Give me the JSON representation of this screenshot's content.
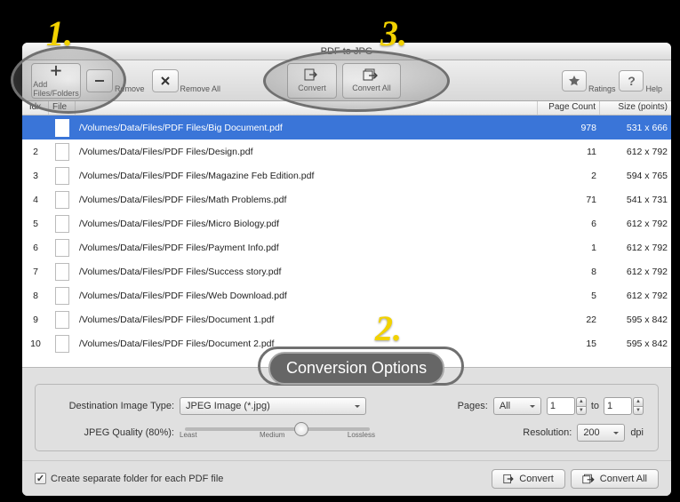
{
  "window_title": "PDF to JPG",
  "toolbar": {
    "add_label": "Add Files/Folders",
    "remove_label": "Remove",
    "remove_all_label": "Remove All",
    "convert_label": "Convert",
    "convert_all_label": "Convert All",
    "ratings_label": "Ratings",
    "help_label": "Help"
  },
  "columns": {
    "idx": "Idx",
    "file": "File",
    "path": "",
    "pages": "Page Count",
    "size": "Size (points)"
  },
  "files": [
    {
      "idx": "",
      "path": "/Volumes/Data/Files/PDF Files/Big Document.pdf",
      "pages": "978",
      "size": "531 x 666",
      "sel": true
    },
    {
      "idx": "2",
      "path": "/Volumes/Data/Files/PDF Files/Design.pdf",
      "pages": "11",
      "size": "612 x 792"
    },
    {
      "idx": "3",
      "path": "/Volumes/Data/Files/PDF Files/Magazine Feb Edition.pdf",
      "pages": "2",
      "size": "594 x 765"
    },
    {
      "idx": "4",
      "path": "/Volumes/Data/Files/PDF Files/Math Problems.pdf",
      "pages": "71",
      "size": "541 x 731"
    },
    {
      "idx": "5",
      "path": "/Volumes/Data/Files/PDF Files/Micro Biology.pdf",
      "pages": "6",
      "size": "612 x 792"
    },
    {
      "idx": "6",
      "path": "/Volumes/Data/Files/PDF Files/Payment Info.pdf",
      "pages": "1",
      "size": "612 x 792"
    },
    {
      "idx": "7",
      "path": "/Volumes/Data/Files/PDF Files/Success story.pdf",
      "pages": "8",
      "size": "612 x 792"
    },
    {
      "idx": "8",
      "path": "/Volumes/Data/Files/PDF Files/Web Download.pdf",
      "pages": "5",
      "size": "612 x 792"
    },
    {
      "idx": "9",
      "path": "/Volumes/Data/Files/PDF Files/Document 1.pdf",
      "pages": "22",
      "size": "595 x 842"
    },
    {
      "idx": "10",
      "path": "/Volumes/Data/Files/PDF Files/Document 2.pdf",
      "pages": "15",
      "size": "595 x 842"
    }
  ],
  "options": {
    "dest_type_label": "Destination Image Type:",
    "dest_type_value": "JPEG Image (*.jpg)",
    "quality_label": "JPEG Quality (80%):",
    "slider_least": "Least",
    "slider_medium": "Medium",
    "slider_lossless": "Lossless",
    "pages_label": "Pages:",
    "pages_value": "All",
    "pages_from": "1",
    "pages_to_label": "to",
    "pages_to": "1",
    "resolution_label": "Resolution:",
    "resolution_value": "200",
    "resolution_unit": "dpi"
  },
  "footer": {
    "checkbox_label": "Create separate folder for each PDF file",
    "convert_label": "Convert",
    "convert_all_label": "Convert All"
  },
  "annotations": {
    "n1": "1.",
    "n2": "2.",
    "n3": "3.",
    "pill": "Conversion Options"
  }
}
